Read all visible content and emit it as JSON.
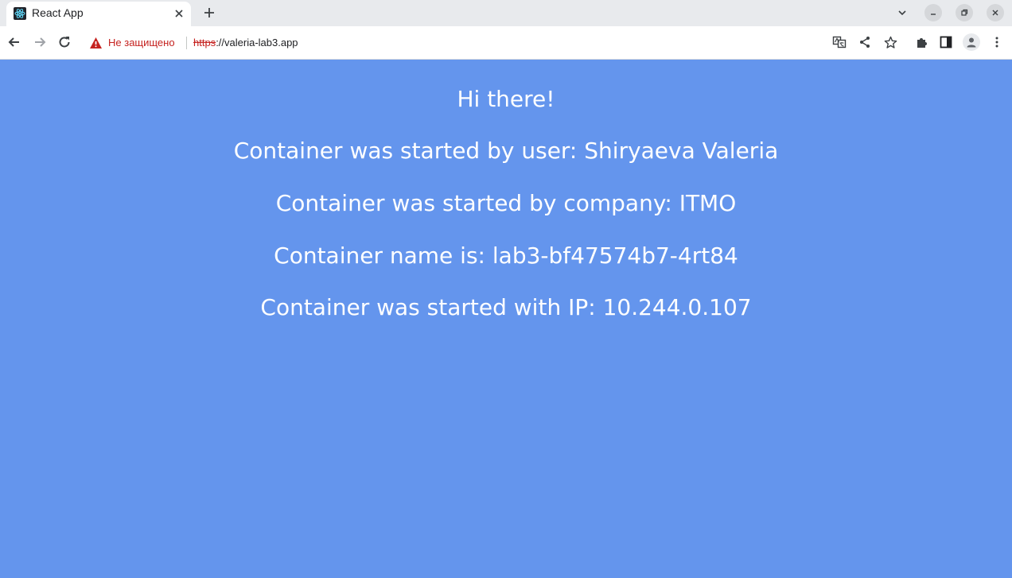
{
  "tab": {
    "title": "React App",
    "favicon": "react-logo-icon"
  },
  "toolbar": {
    "security_label": "Не защищено",
    "url_scheme": "https",
    "url_rest": "://valeria-lab3.app"
  },
  "content": {
    "greeting": "Hi there!",
    "user_line": "Container was started by user: Shiryaeva Valeria",
    "company_line": "Container was started by company: ITMO",
    "name_line": "Container name is: lab3-bf47574b7-4rt84",
    "ip_line": "Container was started with IP: 10.244.0.107"
  },
  "colors": {
    "page_background": "#6495ed",
    "text": "#ffffff",
    "insecure_red": "#c5221f"
  }
}
